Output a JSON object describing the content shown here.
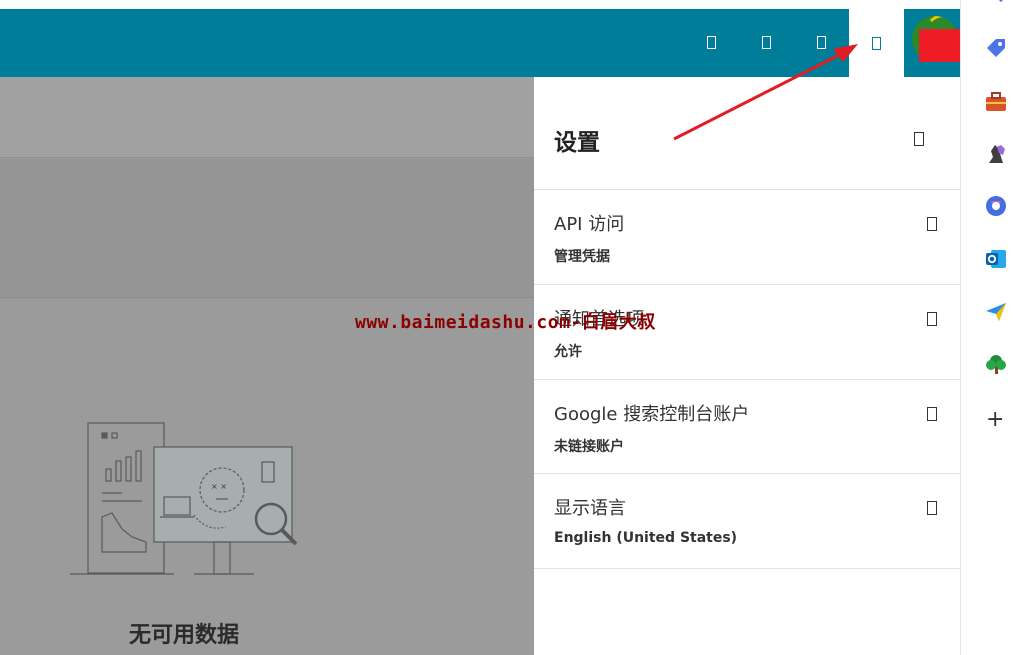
{
  "topbar": {
    "color": "#007e99",
    "icons": [
      "app-icon",
      "app-icon",
      "app-icon",
      "settings-icon"
    ],
    "active_index": 3
  },
  "left": {
    "empty_state": "无可用数据"
  },
  "settings_panel": {
    "title": "设置",
    "items": [
      {
        "title": "API 访问",
        "subtitle": "管理凭据"
      },
      {
        "title": "通知首选项",
        "subtitle": "允许"
      },
      {
        "title": "Google 搜索控制台账户",
        "subtitle": "未链接账户"
      },
      {
        "title": "显示语言",
        "subtitle": "English (United States)"
      }
    ]
  },
  "browser_sidebar": {
    "icons": [
      "search-icon",
      "tag-icon",
      "toolbox-icon",
      "chess-icon",
      "copilot-icon",
      "outlook-icon",
      "send-icon",
      "tree-icon",
      "add-icon"
    ]
  },
  "watermark": "www.baimeidashu.com-白眉大叔"
}
